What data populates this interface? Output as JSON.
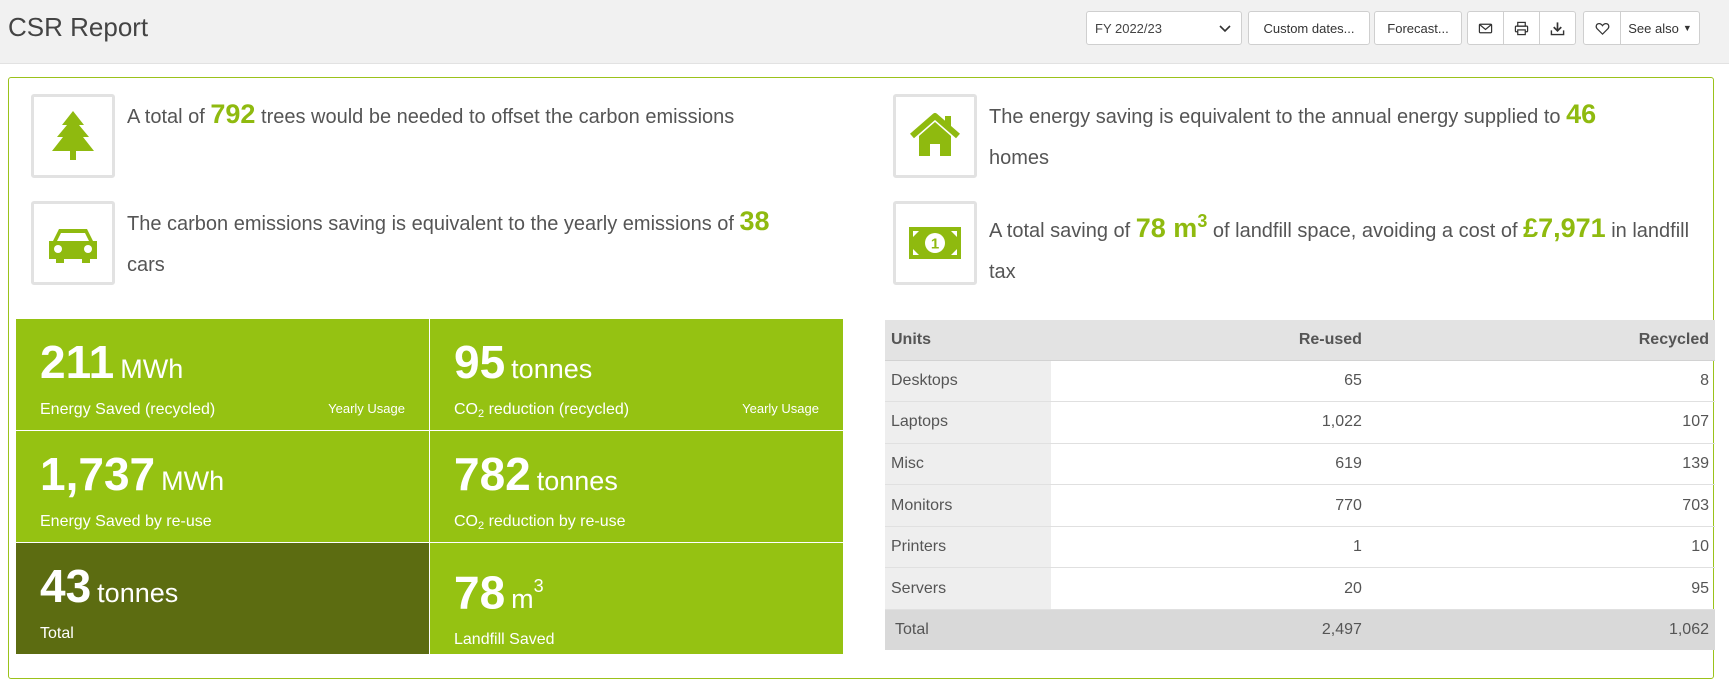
{
  "header": {
    "title": "CSR Report",
    "period_select": "FY 2022/23",
    "custom_dates_label": "Custom dates...",
    "forecast_label": "Forecast...",
    "see_also_label": "See also"
  },
  "icons": {
    "email": "envelope-icon",
    "print": "printer-icon",
    "download": "download-icon",
    "favourite": "heart-icon",
    "tree": "tree-icon",
    "house": "house-icon",
    "car": "car-icon",
    "money": "banknote-icon"
  },
  "colors": {
    "accent": "#95c212",
    "accent_dark": "#5c6c11",
    "number": "#8fba0f"
  },
  "facts": {
    "trees": {
      "pre": "A total of ",
      "value": "792",
      "post": " trees would be needed to offset the carbon emissions"
    },
    "homes": {
      "pre": "The energy saving is equivalent to the annual energy supplied to ",
      "value": "46",
      "post": " homes"
    },
    "cars": {
      "pre": "The carbon emissions saving is equivalent to the yearly emissions of ",
      "value": "38",
      "post": " cars"
    },
    "landfill": {
      "pre": "A total saving of ",
      "value": "78 m",
      "sup": "3",
      "mid": " of landfill space, avoiding a cost of ",
      "cost": "£7,971",
      "post": " in landfill tax"
    }
  },
  "tiles": [
    {
      "value": "211",
      "unit": "MWh",
      "label": "Energy Saved (recycled)",
      "tag": "Yearly Usage"
    },
    {
      "value": "95",
      "unit": "tonnes",
      "label_pre": "CO",
      "label_sub": "2",
      "label_post": " reduction (recycled)",
      "tag": "Yearly Usage"
    },
    {
      "value": "1,737",
      "unit": "MWh",
      "label": "Energy Saved by re-use"
    },
    {
      "value": "782",
      "unit": "tonnes",
      "label_pre": "CO",
      "label_sub": "2",
      "label_post": " reduction by re-use"
    },
    {
      "value": "43",
      "unit": "tonnes",
      "label": "Total"
    },
    {
      "value": "78",
      "unit": "m",
      "unit_sup": "3",
      "label": "Landfill Saved"
    }
  ],
  "table": {
    "headers": [
      "Units",
      "Re-used",
      "Recycled"
    ],
    "rows": [
      [
        "Desktops",
        "65",
        "8"
      ],
      [
        "Laptops",
        "1,022",
        "107"
      ],
      [
        "Misc",
        "619",
        "139"
      ],
      [
        "Monitors",
        "770",
        "703"
      ],
      [
        "Printers",
        "1",
        "10"
      ],
      [
        "Servers",
        "20",
        "95"
      ]
    ],
    "total": [
      "Total",
      "2,497",
      "1,062"
    ]
  }
}
